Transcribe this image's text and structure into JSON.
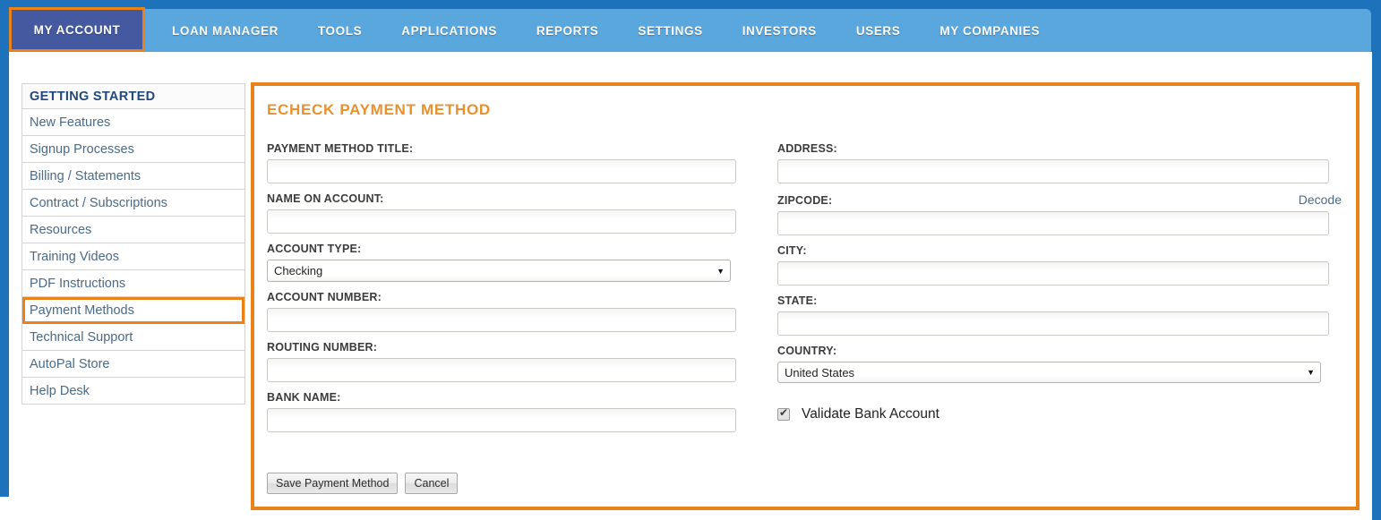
{
  "nav": {
    "items": [
      {
        "label": "MY ACCOUNT",
        "active": true
      },
      {
        "label": "LOAN MANAGER",
        "active": false
      },
      {
        "label": "TOOLS",
        "active": false
      },
      {
        "label": "APPLICATIONS",
        "active": false
      },
      {
        "label": "REPORTS",
        "active": false
      },
      {
        "label": "SETTINGS",
        "active": false
      },
      {
        "label": "INVESTORS",
        "active": false
      },
      {
        "label": "USERS",
        "active": false
      },
      {
        "label": "MY COMPANIES",
        "active": false
      }
    ]
  },
  "sidebar": {
    "header": "GETTING STARTED",
    "items": [
      {
        "label": "New Features",
        "highlighted": false
      },
      {
        "label": "Signup Processes",
        "highlighted": false
      },
      {
        "label": "Billing / Statements",
        "highlighted": false
      },
      {
        "label": "Contract / Subscriptions",
        "highlighted": false
      },
      {
        "label": "Resources",
        "highlighted": false
      },
      {
        "label": "Training Videos",
        "highlighted": false
      },
      {
        "label": "PDF Instructions",
        "highlighted": false
      },
      {
        "label": "Payment Methods",
        "highlighted": true
      },
      {
        "label": "Technical Support",
        "highlighted": false
      },
      {
        "label": "AutoPal Store",
        "highlighted": false
      },
      {
        "label": "Help Desk",
        "highlighted": false
      }
    ]
  },
  "panel": {
    "title": "ECHECK PAYMENT METHOD",
    "left_fields": [
      {
        "label": "PAYMENT METHOD TITLE:",
        "value": "",
        "type": "text"
      },
      {
        "label": "NAME ON ACCOUNT:",
        "value": "",
        "type": "text"
      },
      {
        "label": "ACCOUNT TYPE:",
        "value": "Checking",
        "type": "select"
      },
      {
        "label": "ACCOUNT NUMBER:",
        "value": "",
        "type": "text"
      },
      {
        "label": "ROUTING NUMBER:",
        "value": "",
        "type": "text"
      },
      {
        "label": "BANK NAME:",
        "value": "",
        "type": "text"
      }
    ],
    "right_fields": [
      {
        "label": "ADDRESS:",
        "value": "",
        "type": "text"
      },
      {
        "label": "ZIPCODE:",
        "value": "",
        "type": "text",
        "aux_link": "Decode"
      },
      {
        "label": "CITY:",
        "value": "",
        "type": "text"
      },
      {
        "label": "STATE:",
        "value": "",
        "type": "text"
      },
      {
        "label": "COUNTRY:",
        "value": "United States",
        "type": "select"
      }
    ],
    "checkbox": {
      "label": "Validate Bank Account",
      "checked": true
    },
    "buttons": [
      {
        "label": "Save Payment Method"
      },
      {
        "label": "Cancel"
      }
    ]
  },
  "colors": {
    "nav_dark_blue": "#1d72bb",
    "nav_light_blue": "#5aa7de",
    "active_tab_bg": "#44599f",
    "accent_orange": "#e8821a",
    "title_orange": "#e8912f",
    "link_blue": "#4a6a87",
    "sidebar_header": "#23497a"
  }
}
